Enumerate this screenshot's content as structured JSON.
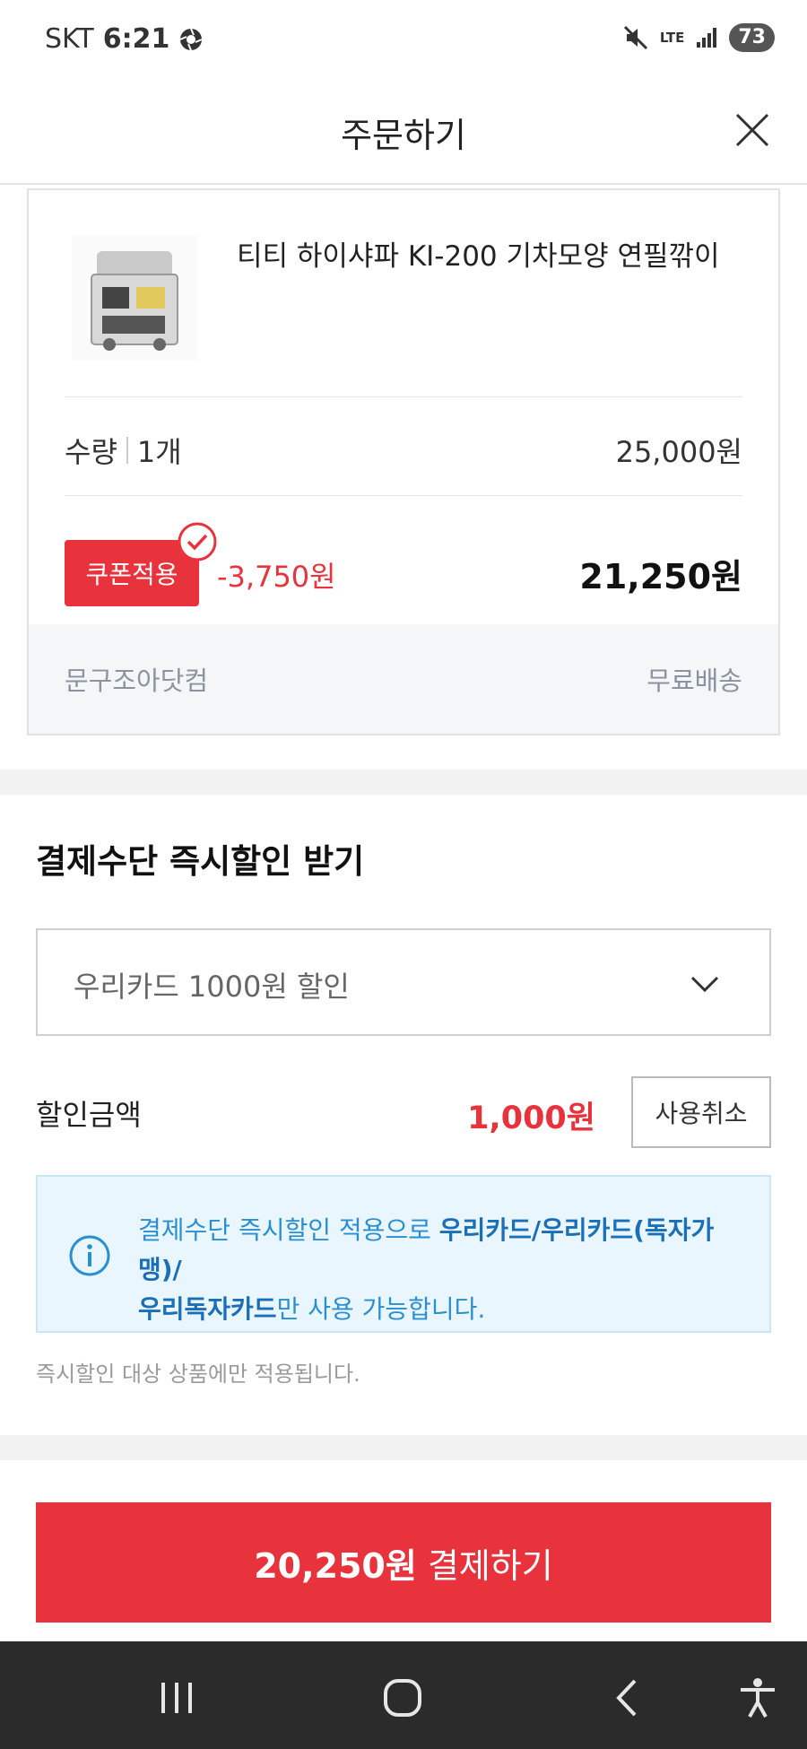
{
  "status_bar": {
    "carrier": "SKT",
    "time": "6:21",
    "network": "LTE",
    "battery": "73"
  },
  "header": {
    "title": "주문하기"
  },
  "product": {
    "name": "티티 하이샤파 KI-200 기차모양 연필깎이",
    "quantity_label": "수량",
    "quantity_value": "1개",
    "original_price": "25,000원",
    "coupon_label": "쿠폰적용",
    "coupon_discount": "-3,750원",
    "final_price": "21,250원",
    "seller": "문구조아닷컴",
    "shipping": "무료배송"
  },
  "payment_discount": {
    "title": "결제수단 즉시할인 받기",
    "selected_option": "우리카드 1000원 할인",
    "discount_label": "할인금액",
    "discount_amount": "1,000원",
    "cancel_label": "사용취소",
    "info_prefix": "결제수단 즉시할인 적용으로 ",
    "info_cards": "우리카드/우리카드(독자가맹)/",
    "info_cards2": "우리독자카드",
    "info_suffix": "만 사용 가능합니다.",
    "note": "즉시할인 대상 상품에만 적용됩니다."
  },
  "pay_button": {
    "amount": "20,250원",
    "label": " 결제하기"
  },
  "colors": {
    "accent": "#e8323c",
    "info": "#2a8fd0"
  }
}
